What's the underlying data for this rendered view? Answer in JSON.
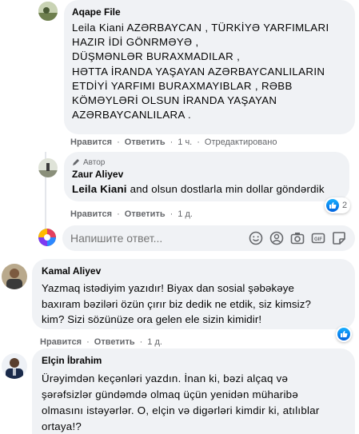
{
  "comment1": {
    "author": "Aqape File",
    "text": "Leila Kiani AZƏRBAYCAN , TÜRKİYƏ YARFIMLARI\nHAZIR İDİ GÖNRMƏYƏ ,\nDÜŞMƏNLƏR BURAXMADILAR ,\nHƏTTA İRANDA YAŞAYAN AZƏRBAYCANLILARIN\nETDİYİ YARFIMI BURAXMAYIBLAR , RƏBB\nKÖMƏYLƏRİ OLSUN İRANDA YAŞAYAN\nAZƏRBAYCANLILARA .",
    "like": "Нравится",
    "reply": "Ответить",
    "time": "1 ч.",
    "edited": "Отредактировано"
  },
  "comment2": {
    "badge": "Автор",
    "author": "Zaur Aliyev",
    "mention": "Leila Kiani",
    "text": " and olsun dostlarla min dollar göndərdik",
    "like": "Нравится",
    "reply": "Ответить",
    "time": "1 д.",
    "reaction_count": "2"
  },
  "reply_box": {
    "placeholder": "Напишите ответ..."
  },
  "comment3": {
    "author": "Kamal Aliyev",
    "text": "Yazmaq istədiyim yazıdır! Biyax dan sosial şəbəkəye\nbaxıram bəziləri özün çırır biz dedik ne etdik, siz kimsiz?\nkim? Sizi sözünüze ora gelen ele sizin kimidir!",
    "like": "Нравится",
    "reply": "Ответить",
    "time": "1 д."
  },
  "comment4": {
    "author": "Elçin İbrahim",
    "text": "Ürəyimdən keçənləri yazdın. İnan ki, bəzi alçaq və\nşərəfsizlər gündəmdə olmaq üçün yenidən müharibə\nolmasını istəyərlər. O, elçin və digərləri kimdir ki, atılıblar\nortaya!?"
  },
  "colors": {
    "bubble": "#f0f2f5",
    "meta": "#65676b",
    "like_blue": "#1877f2"
  }
}
